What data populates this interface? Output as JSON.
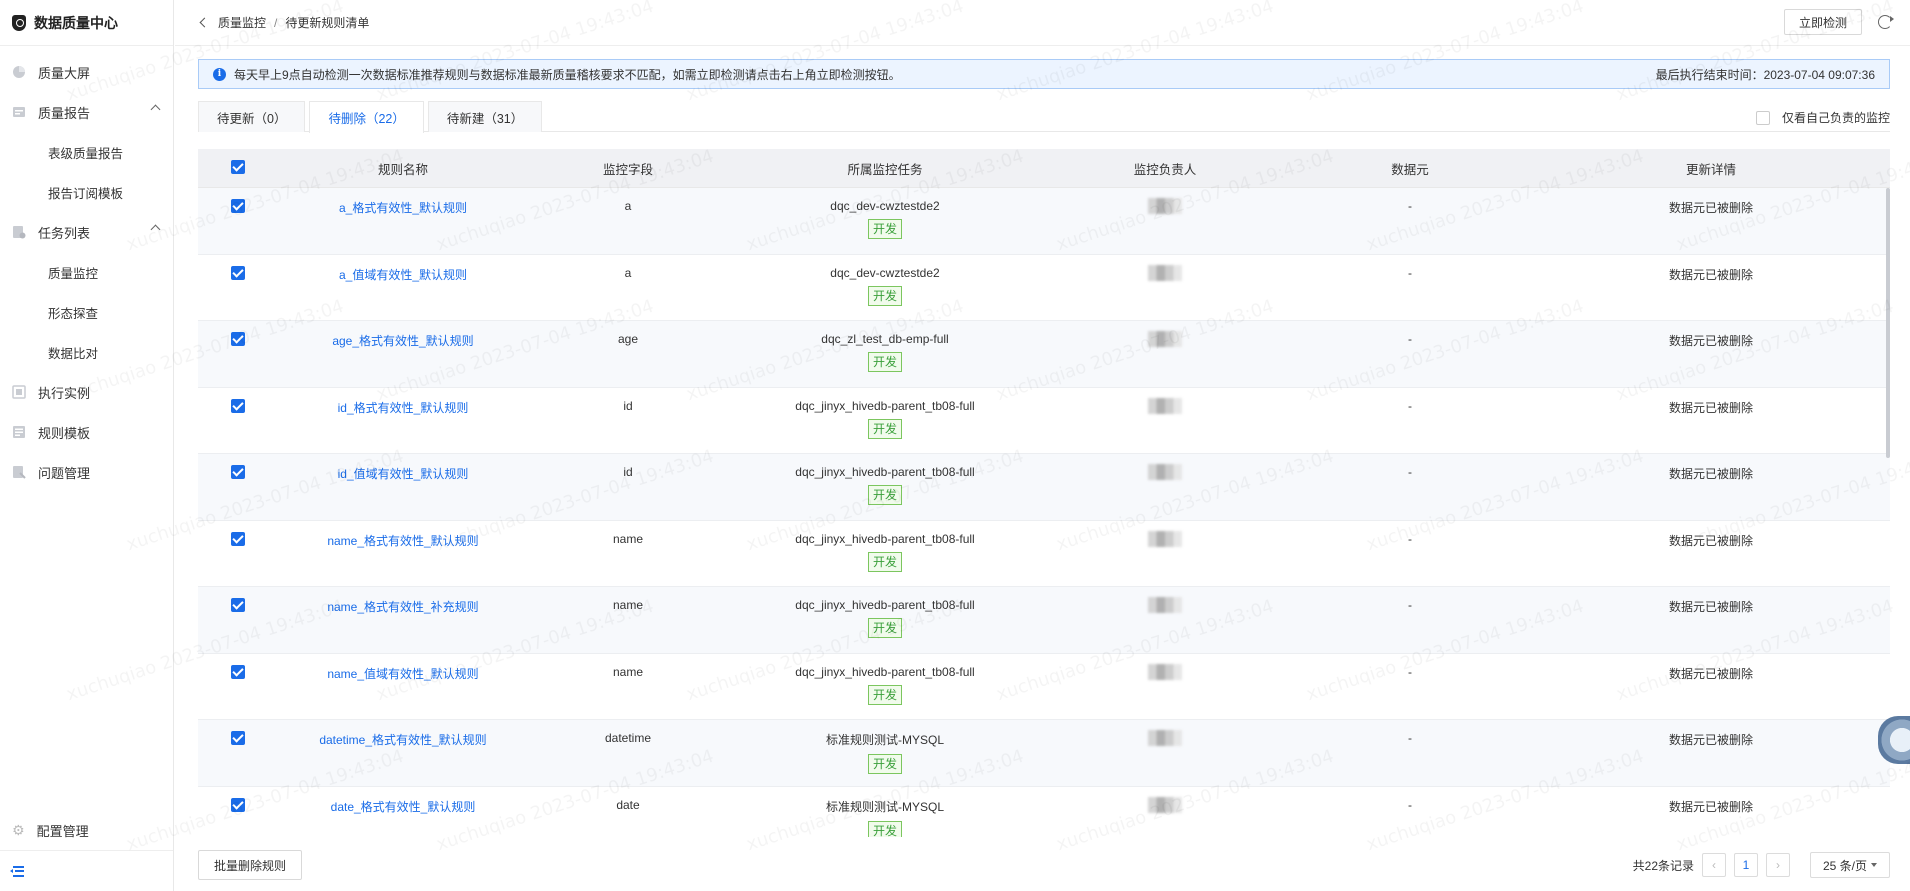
{
  "app": {
    "title": "数据质量中心"
  },
  "sidebar": {
    "items": [
      {
        "label": "质量大屏",
        "icon": "pie-chart-icon",
        "type": "item"
      },
      {
        "label": "质量报告",
        "icon": "report-icon",
        "type": "group",
        "expanded": true
      },
      {
        "label": "表级质量报告",
        "type": "sub"
      },
      {
        "label": "报告订阅模板",
        "type": "sub"
      },
      {
        "label": "任务列表",
        "icon": "task-list-icon",
        "type": "group",
        "expanded": true
      },
      {
        "label": "质量监控",
        "type": "sub"
      },
      {
        "label": "形态探查",
        "type": "sub"
      },
      {
        "label": "数据比对",
        "type": "sub"
      },
      {
        "label": "执行实例",
        "icon": "instance-icon",
        "type": "item"
      },
      {
        "label": "规则模板",
        "icon": "template-icon",
        "type": "item"
      },
      {
        "label": "问题管理",
        "icon": "issue-icon",
        "type": "item"
      }
    ],
    "config_label": "配置管理"
  },
  "header": {
    "breadcrumb": [
      "质量监控",
      "待更新规则清单"
    ],
    "check_now_label": "立即检测"
  },
  "banner": {
    "text": "每天早上9点自动检测一次数据标准推荐规则与数据标准最新质量稽核要求不匹配，如需立即检测请点击右上角立即检测按钮。",
    "last_run": "最后执行结束时间：2023-07-04 09:07:36"
  },
  "tabs": [
    {
      "label": "待更新（0）",
      "active": false
    },
    {
      "label": "待删除（22）",
      "active": true
    },
    {
      "label": "待新建（31）",
      "active": false
    }
  ],
  "own_filter_label": "仅看自己负责的监控",
  "table": {
    "columns": [
      "规则名称",
      "监控字段",
      "所属监控任务",
      "监控负责人",
      "数据元",
      "更新详情"
    ],
    "rows": [
      {
        "rule": "a_格式有效性_默认规则",
        "field": "a",
        "task": "dqc_dev-cwztestde2",
        "env": "开发",
        "element": "-",
        "detail": "数据元已被删除"
      },
      {
        "rule": "a_值域有效性_默认规则",
        "field": "a",
        "task": "dqc_dev-cwztestde2",
        "env": "开发",
        "element": "-",
        "detail": "数据元已被删除"
      },
      {
        "rule": "age_格式有效性_默认规则",
        "field": "age",
        "task": "dqc_zl_test_db-emp-full",
        "env": "开发",
        "element": "-",
        "detail": "数据元已被删除"
      },
      {
        "rule": "id_格式有效性_默认规则",
        "field": "id",
        "task": "dqc_jinyx_hivedb-parent_tb08-full",
        "env": "开发",
        "element": "-",
        "detail": "数据元已被删除"
      },
      {
        "rule": "id_值域有效性_默认规则",
        "field": "id",
        "task": "dqc_jinyx_hivedb-parent_tb08-full",
        "env": "开发",
        "element": "-",
        "detail": "数据元已被删除"
      },
      {
        "rule": "name_格式有效性_默认规则",
        "field": "name",
        "task": "dqc_jinyx_hivedb-parent_tb08-full",
        "env": "开发",
        "element": "-",
        "detail": "数据元已被删除"
      },
      {
        "rule": "name_格式有效性_补充规则",
        "field": "name",
        "task": "dqc_jinyx_hivedb-parent_tb08-full",
        "env": "开发",
        "element": "-",
        "detail": "数据元已被删除"
      },
      {
        "rule": "name_值域有效性_默认规则",
        "field": "name",
        "task": "dqc_jinyx_hivedb-parent_tb08-full",
        "env": "开发",
        "element": "-",
        "detail": "数据元已被删除"
      },
      {
        "rule": "datetime_格式有效性_默认规则",
        "field": "datetime",
        "task": "标准规则测试-MYSQL",
        "env": "开发",
        "element": "-",
        "detail": "数据元已被删除"
      },
      {
        "rule": "date_格式有效性_默认规则",
        "field": "date",
        "task": "标准规则测试-MYSQL",
        "env": "开发",
        "element": "-",
        "detail": "数据元已被删除"
      }
    ]
  },
  "footer": {
    "batch_delete_label": "批量删除规则",
    "total_label": "共22条记录",
    "current_page": "1",
    "page_size_label": "25 条/页"
  },
  "watermark_text": "xuchuqiao 2023-07-04 19:43:04",
  "colors": {
    "accent": "#1a6ce8",
    "tag_green": "#3ba03b",
    "banner_bg": "#ecf4ff"
  }
}
